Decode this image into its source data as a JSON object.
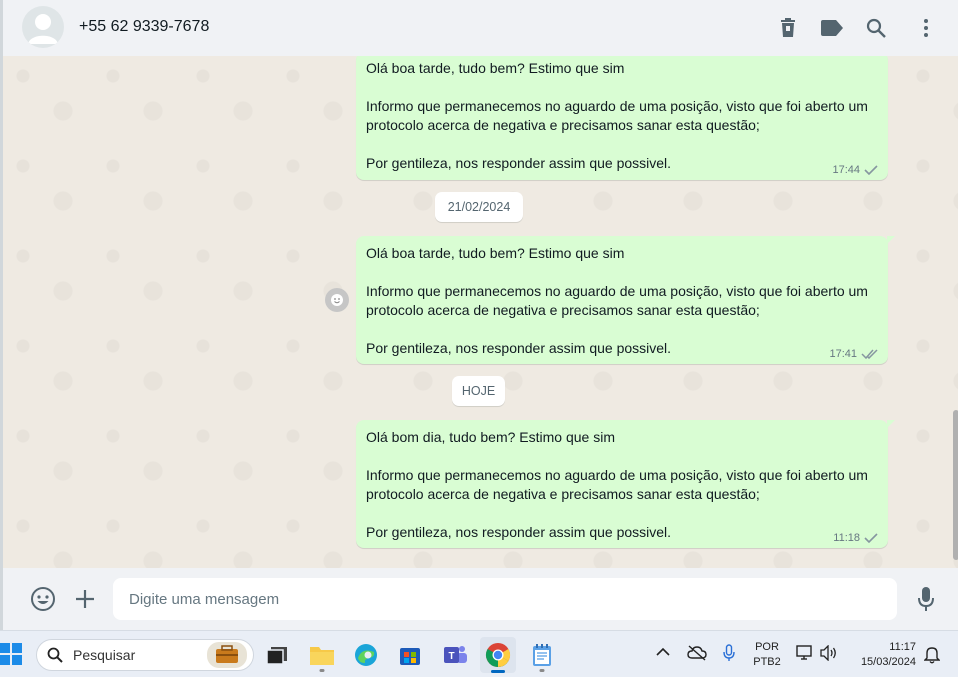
{
  "header": {
    "contact_name": "+55 62 9339-7678",
    "icons": [
      "trash-icon",
      "label-icon",
      "search-icon",
      "menu-kebab-icon"
    ]
  },
  "messages": [
    {
      "lines": [
        "Olá boa tarde, tudo bem? Estimo que sim",
        "",
        "Informo que permanecemos no aguardo de uma posição, visto que foi aberto um",
        "protocolo acerca de negativa e precisamos sanar esta questão;",
        "",
        "Por gentileza, nos responder assim que possivel."
      ],
      "time": "17:44",
      "status": "sent"
    },
    {
      "lines": [
        "Olá boa tarde, tudo bem? Estimo que sim",
        "",
        "Informo que permanecemos no aguardo de uma posição, visto que foi aberto um",
        "protocolo acerca de negativa e precisamos sanar esta questão;",
        "",
        "Por gentileza, nos responder assim que possivel."
      ],
      "time": "17:41",
      "status": "delivered"
    },
    {
      "lines": [
        "Olá bom dia, tudo bem? Estimo que sim",
        "",
        "Informo que permanecemos no aguardo de uma posição, visto que foi aberto um",
        "protocolo acerca de negativa e precisamos sanar esta questão;",
        "",
        "Por gentileza, nos responder assim que possivel."
      ],
      "time": "11:18",
      "status": "sent"
    }
  ],
  "date_separators": [
    "21/02/2024",
    "HOJE"
  ],
  "composer": {
    "placeholder": "Digite uma mensagem"
  },
  "taskbar": {
    "search_label": "Pesquisar",
    "language_line1": "POR",
    "language_line2": "PTB2",
    "clock_time": "11:17",
    "clock_date": "15/03/2024"
  },
  "colors": {
    "outgoing_bubble": "#d9fdd3",
    "chat_background": "#efeae2",
    "header_background": "#f0f2f5",
    "tick_gray": "#8696a0"
  }
}
